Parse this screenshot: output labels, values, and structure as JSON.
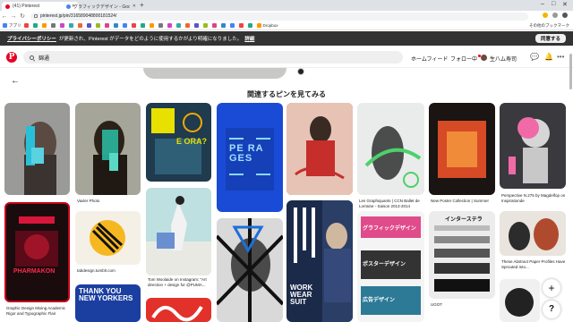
{
  "browser": {
    "tabs": [
      {
        "title": "(41) Pinterest",
        "active": true
      },
      {
        "title": "グラフィックデザイン - Google 検索",
        "active": false
      }
    ],
    "url": "pinterest.jp/pin/316589048800181524/",
    "bookmarks": [
      "アプリ",
      "",
      "",
      "",
      "",
      "",
      "",
      "",
      "",
      "",
      "",
      "",
      "",
      "",
      "",
      "",
      "",
      "",
      "",
      "",
      "",
      "",
      "",
      "",
      "",
      "",
      "",
      "Dropbox"
    ],
    "other_bookmarks": "その他のブックマーク"
  },
  "privacy_banner": {
    "policy_link": "プライバシーポリシー",
    "message": "が更新され、Pinterest がデータをどのように使用するかがより明確になりました。",
    "detail_link": "詳細",
    "ok_button": "同意する"
  },
  "header": {
    "logo": "P",
    "search_value": "錦通",
    "home_feed": "ホームフィード",
    "following": "フォロー中",
    "username": "生八ム寿司"
  },
  "section_title": "関連するピンを見てみる",
  "captions": {
    "pin2": "Vaxler Photo",
    "pin7": "Les Graphiquants | CCN Ballet de Lorraine - Saison 2013-2014",
    "pin8": "New Poster Collection | Summer",
    "pin9": "Perspective N.275 by Magdelfop on Inspirationde",
    "pin10": "Graphic Design Mixing Academic Rigor and Typographic Flair",
    "pin11": "tabdesign.tumblr.com",
    "pin12": "Tom Woolaide on Instagram: \"Art direction + design for @PUMA...",
    "pin16": "UGOT",
    "pin17": "These Abstract Paper Profiles Have Sprouted Into..."
  },
  "poster_texts": {
    "e_ora": "E ORA?",
    "peraoes": "PE RA GES",
    "work_wear": "WORK WEAR SUIT",
    "pharmakon": "PHARMAKON",
    "thank_you": "THANK YOU NEW YORKERS",
    "interstella": "インターステラ",
    "graphic_jp": "グラフィックデザイン",
    "poster_jp": "ポスターデザイン",
    "ad_jp": "広告デザイン"
  },
  "colors": {
    "pinterest_red": "#e60023",
    "banner_bg": "#333333"
  }
}
